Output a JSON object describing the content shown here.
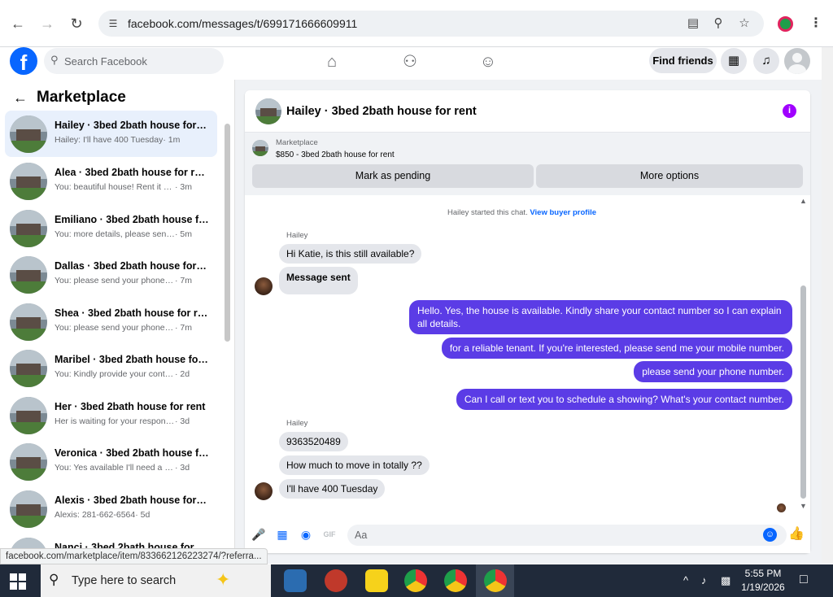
{
  "browser": {
    "url": "facebook.com/messages/t/699171666609911",
    "status_url": "facebook.com/marketplace/item/833662126223274/?referra..."
  },
  "fb_header": {
    "logo": "f",
    "search_placeholder": "Search Facebook",
    "find_friends": "Find friends"
  },
  "left_panel": {
    "title": "Marketplace",
    "conversations": [
      {
        "name": "Hailey · 3bed 2bath house for r...",
        "preview": "Hailey: I'll have 400 Tuesday",
        "time": "· 1m",
        "active": true
      },
      {
        "name": "Alea · 3bed 2bath house for rent",
        "preview": "You: beautiful house! Rent it out a...",
        "time": "· 3m"
      },
      {
        "name": "Emiliano · 3bed 2bath house for...",
        "preview": "You: more details, please send yo...",
        "time": "· 5m"
      },
      {
        "name": "Dallas · 3bed 2bath house for re...",
        "preview": "You: please send your phone num...",
        "time": "· 7m"
      },
      {
        "name": "Shea · 3bed 2bath house for rent",
        "preview": "You: please send your phone num...",
        "time": "· 7m"
      },
      {
        "name": "Maribel · 3bed 2bath house for ...",
        "preview": "You: Kindly provide your contact n...",
        "time": "· 2d"
      },
      {
        "name": "Her · 3bed 2bath house for rent",
        "preview": "Her is waiting for your response.",
        "time": "· 3d"
      },
      {
        "name": "Veronica · 3bed 2bath house for...",
        "preview": "You: Yes available I'll need a numb...",
        "time": "· 3d"
      },
      {
        "name": "Alexis · 3bed 2bath house for re...",
        "preview": "Alexis: 281-662-6564",
        "time": "· 5d"
      },
      {
        "name": "Nanci · 3bed 2bath house for rent",
        "preview": "",
        "time": ""
      }
    ]
  },
  "chat": {
    "title": "Hailey · 3bed 2bath house for rent",
    "marketplace_label": "Marketplace",
    "listing": "$850 - 3bed 2bath house for rent",
    "mark_pending": "Mark as pending",
    "more_options": "More options",
    "started": "Hailey started this chat.",
    "view_profile": "View buyer profile",
    "sender": "Hailey",
    "messages": [
      {
        "from": "them",
        "text": "Hi Katie, is this still available?"
      },
      {
        "from": "them",
        "text": "Message sent"
      },
      {
        "from": "me",
        "text": "Hello. Yes, the house is available. Kindly share your contact number so I can explain all details."
      },
      {
        "from": "me",
        "text": "for a reliable tenant. If you're interested, please send me your mobile number."
      },
      {
        "from": "me",
        "text": "please send your phone number."
      },
      {
        "from": "me",
        "text": "Can I call or text you to schedule a showing? What's your contact number."
      },
      {
        "from": "them",
        "text": "9363520489"
      },
      {
        "from": "them",
        "text": "How much to move in totally ??"
      },
      {
        "from": "them",
        "text": "I'll have 400 Tuesday"
      }
    ],
    "composer_placeholder": "Aa"
  },
  "taskbar": {
    "search_placeholder": "Type here to search",
    "time": "5:55 PM",
    "date": "1/19/2026"
  },
  "colors": {
    "fb_blue": "#0866ff",
    "outgoing_bubble": "#5b3ce6",
    "info_purple": "#a000ff"
  }
}
